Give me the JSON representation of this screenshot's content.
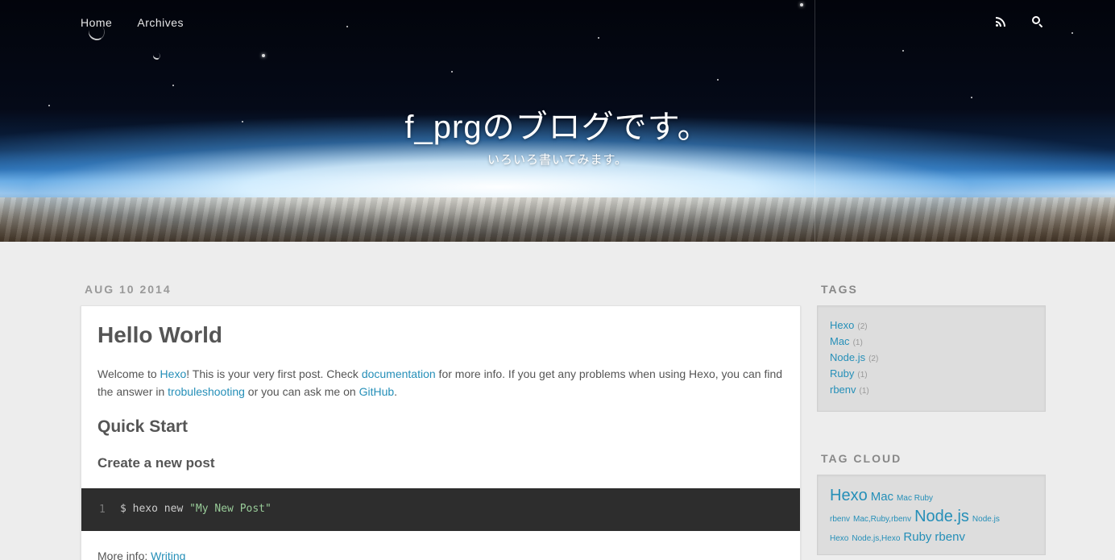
{
  "nav": {
    "home": "Home",
    "archives": "Archives"
  },
  "header": {
    "title": "f_prgのブログです。",
    "subtitle": "いろいろ書いてみます。"
  },
  "icons": {
    "rss": "rss-icon",
    "search": "search-icon"
  },
  "post": {
    "date": "AUG 10 2014",
    "title": "Hello World",
    "intro": {
      "t1": "Welcome to ",
      "l1": "Hexo",
      "t2": "! This is your very first post. Check ",
      "l2": "documentation",
      "t3": " for more info. If you get any problems when using Hexo, you can find the answer in ",
      "l3": "trobuleshooting",
      "t4": " or you can ask me on ",
      "l4": "GitHub",
      "t5": "."
    },
    "h2": "Quick Start",
    "h3": "Create a new post",
    "code": {
      "line": "1",
      "cmd": "$ hexo new ",
      "arg": "\"My New Post\""
    },
    "more_label": "More info: ",
    "more_link": "Writing"
  },
  "sidebar": {
    "tags_title": "TAGS",
    "tags": [
      {
        "name": "Hexo",
        "count": "(2)"
      },
      {
        "name": "Mac",
        "count": "(1)"
      },
      {
        "name": "Node.js",
        "count": "(2)"
      },
      {
        "name": "Ruby",
        "count": "(1)"
      },
      {
        "name": "rbenv",
        "count": "(1)"
      }
    ],
    "cloud_title": "TAG CLOUD",
    "cloud": [
      {
        "name": "Hexo"
      },
      {
        "name": "Mac"
      },
      {
        "name": "Mac Ruby"
      },
      {
        "name": "rbenv"
      },
      {
        "name": "Mac,Ruby,rbenv"
      },
      {
        "name": "Node.js"
      },
      {
        "name": "Node.js"
      },
      {
        "name": "Hexo"
      },
      {
        "name": "Node.js,Hexo"
      },
      {
        "name": "Ruby"
      },
      {
        "name": "rbenv"
      }
    ]
  },
  "colors": {
    "link": "#258fb8",
    "page_bg": "#ededed",
    "code_bg": "#2d2d2d"
  }
}
